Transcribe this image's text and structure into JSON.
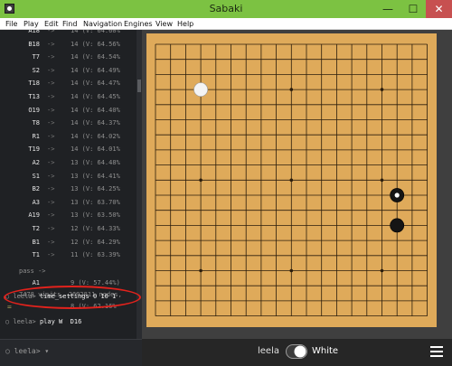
{
  "window": {
    "title": "Sabaki",
    "minimize": "—",
    "maximize": "☐",
    "close": "✕",
    "icon": "sabaki-app-icon"
  },
  "menu": [
    "File",
    "Play",
    "Edit",
    "Find",
    "Navigation",
    "Engines",
    "View",
    "Help"
  ],
  "console": {
    "analysis_rows": [
      {
        "move": "A18",
        "arrow": "->",
        "detail": "14 (V: 64.60%"
      },
      {
        "move": "B18",
        "arrow": "->",
        "detail": "14 (V: 64.56%"
      },
      {
        "move": "T7",
        "arrow": "->",
        "detail": "14 (V: 64.54%"
      },
      {
        "move": "S2",
        "arrow": "->",
        "detail": "14 (V: 64.49%"
      },
      {
        "move": "T18",
        "arrow": "->",
        "detail": "14 (V: 64.47%"
      },
      {
        "move": "T13",
        "arrow": "->",
        "detail": "14 (V: 64.45%"
      },
      {
        "move": "O19",
        "arrow": "->",
        "detail": "14 (V: 64.40%"
      },
      {
        "move": "T8",
        "arrow": "->",
        "detail": "14 (V: 64.37%"
      },
      {
        "move": "R1",
        "arrow": "->",
        "detail": "14 (V: 64.02%"
      },
      {
        "move": "T19",
        "arrow": "->",
        "detail": "14 (V: 64.01%"
      },
      {
        "move": "A2",
        "arrow": "->",
        "detail": "13 (V: 64.48%"
      },
      {
        "move": "S1",
        "arrow": "->",
        "detail": "13 (V: 64.41%"
      },
      {
        "move": "B2",
        "arrow": "->",
        "detail": "13 (V: 64.25%"
      },
      {
        "move": "A3",
        "arrow": "->",
        "detail": "13 (V: 63.70%"
      },
      {
        "move": "A19",
        "arrow": "->",
        "detail": "13 (V: 63.50%"
      },
      {
        "move": "T2",
        "arrow": "->",
        "detail": "12 (V: 64.33%"
      },
      {
        "move": "B1",
        "arrow": "->",
        "detail": "12 (V: 64.29%"
      },
      {
        "move": "T1",
        "arrow": "->",
        "detail": "11 (V: 63.39%"
      }
    ],
    "pass_row": {
      "move": "pass ->",
      "detail": "9 (V: 57.44%)"
    },
    "last_row": {
      "move": "A1",
      "arrow": "->",
      "detail": "8 (V: 62.16%"
    },
    "summary": "7478 visits, 2692811 nodes,",
    "commands": [
      {
        "prompt": "○ leela>",
        "command": "time_settings 0 10 1",
        "response": "="
      },
      {
        "prompt": "○ leela>",
        "command": "play W  D16",
        "response": ""
      }
    ],
    "input_prompt": "○ leela> ▾"
  },
  "board": {
    "size": 19,
    "stones": [
      {
        "color": "white",
        "point": "D16",
        "last_move": false
      },
      {
        "color": "black",
        "point": "R9",
        "last_move": true
      },
      {
        "color": "black",
        "point": "R7",
        "last_move": false
      }
    ],
    "star_points": [
      "D16",
      "K16",
      "Q16",
      "D10",
      "K10",
      "Q10",
      "D4",
      "K4",
      "Q4"
    ]
  },
  "players": {
    "black": "leela",
    "white": "White",
    "toggle_state": "white-to-play"
  },
  "colors": {
    "titlebar": "#7cc242",
    "board": "#dfaa5a",
    "console_bg": "#1f2124",
    "annotation": "#e3221c"
  }
}
